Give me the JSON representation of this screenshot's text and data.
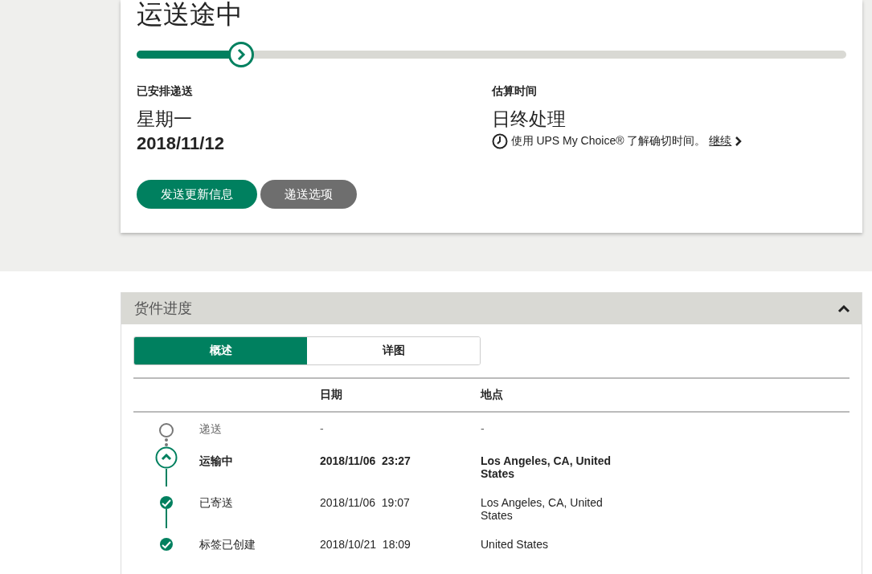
{
  "status_card": {
    "title": "运送途中",
    "progress": {
      "level": 0.147
    },
    "scheduled": {
      "label": "已安排递送",
      "day": "星期一",
      "date": "2018/11/12"
    },
    "estimated": {
      "label": "估算时间",
      "value": "日终处理",
      "note_before": "使用 ",
      "note_brand": "UPS My Choice®",
      "note_after": " 了解确切时间。",
      "link": "继续"
    },
    "buttons": [
      {
        "label": "发送更新信息",
        "kind": "primary"
      },
      {
        "label": "递送选项",
        "kind": "secondary"
      }
    ]
  },
  "progress_panel": {
    "title": "货件进度",
    "expanded": true,
    "tabs": [
      {
        "label": "概述",
        "selected": true
      },
      {
        "label": "详图",
        "selected": false
      }
    ],
    "columns": [
      "日期",
      "地点"
    ],
    "rows": [
      {
        "kind": "pending",
        "status": "递送",
        "date": "-",
        "location": "-"
      },
      {
        "kind": "current",
        "status": "运输中",
        "date": "2018/11/06  23:27",
        "location": "Los Angeles, CA, United States"
      },
      {
        "kind": "done",
        "status": "已寄送",
        "date": "2018/11/06  19:07",
        "location": "Los Angeles, CA, United States"
      },
      {
        "kind": "done",
        "status": "标签已创建",
        "date": "2018/10/21  18:09",
        "location": "United States"
      }
    ]
  }
}
